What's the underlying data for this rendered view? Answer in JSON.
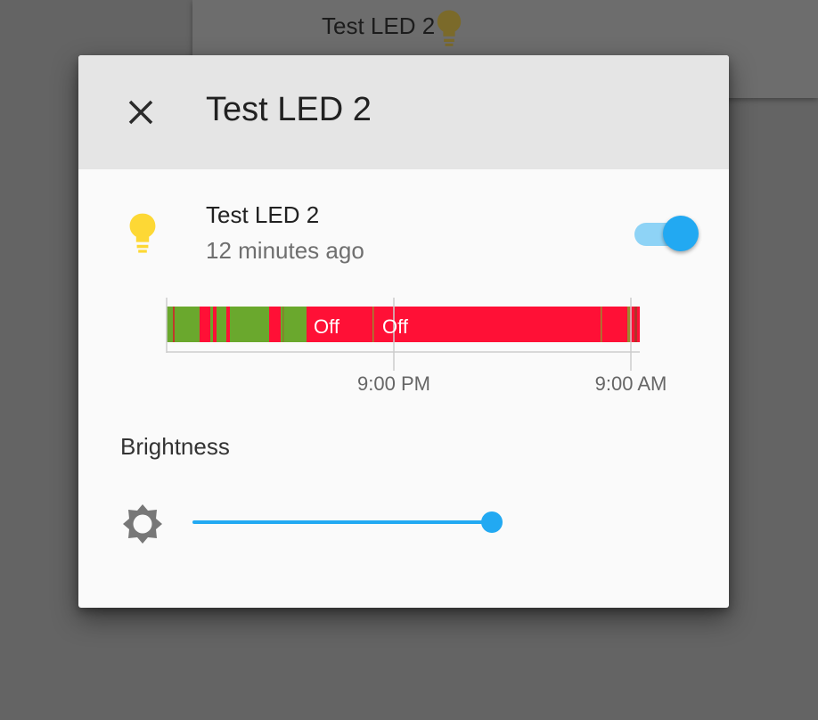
{
  "background_card": {
    "title": "Test LED 2",
    "icon": "lightbulb-icon"
  },
  "dialog": {
    "title": "Test LED 2",
    "close_icon": "close-icon"
  },
  "entity": {
    "name": "Test LED 2",
    "last_changed": "12 minutes ago",
    "icon": "lightbulb-icon",
    "icon_color": "#fdd835",
    "state": "on"
  },
  "timeline": {
    "on_color": "#6aa82d",
    "off_color": "#ff1036",
    "segment_labels": [
      "Off",
      "Off"
    ],
    "tick_labels": [
      "9:00 PM",
      "9:00 AM"
    ]
  },
  "brightness": {
    "label": "Brightness",
    "icon": "brightness-icon",
    "value_percent": 100
  },
  "colors": {
    "accent": "#22a9f2",
    "header_bg": "#e5e5e5"
  }
}
